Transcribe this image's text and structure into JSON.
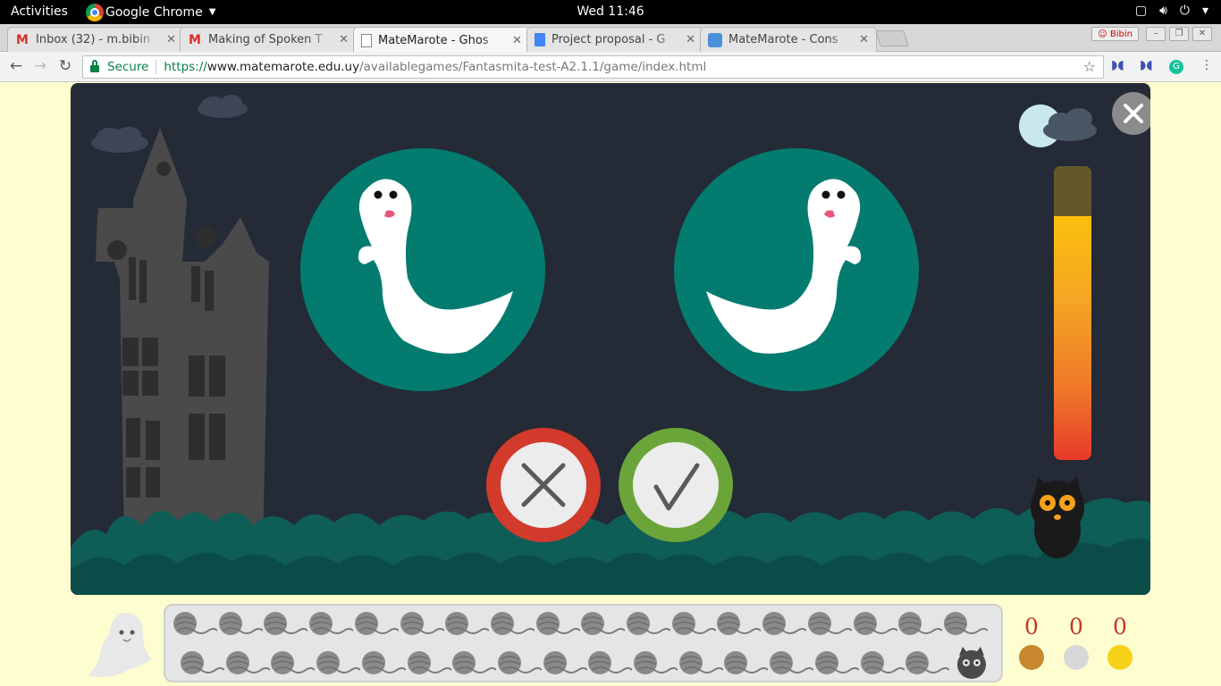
{
  "system_bar": {
    "activities": "Activities",
    "app_name": "Google Chrome",
    "clock": "Wed 11:46"
  },
  "tabs": [
    {
      "title": "Inbox (32) - m.bibin",
      "icon": "gmail-icon",
      "active": false
    },
    {
      "title": "Making of Spoken T",
      "icon": "gmail-icon",
      "active": false
    },
    {
      "title": "MateMarote - Ghos",
      "icon": "page-icon",
      "active": true
    },
    {
      "title": "Project proposal - G",
      "icon": "google-docs-icon",
      "active": false
    },
    {
      "title": "MateMarote - Cons",
      "icon": "matemarote-icon",
      "active": false
    }
  ],
  "profile_name": "Bibin",
  "omnibox": {
    "secure_label": "Secure",
    "scheme": "https://",
    "host": "www.matemarote.edu.uy",
    "path": "/availablegames/Fantasmita-test-A2.1.1/game/index.html"
  },
  "game": {
    "timer_remaining_fraction": 0.83,
    "ghost_left": "ghost-facing-right",
    "ghost_right": "ghost-facing-left",
    "buttons": [
      "wrong-answer",
      "correct-answer"
    ]
  },
  "hud": {
    "yarn_balls_total": 35,
    "yarn_balls_row1": 18,
    "yarn_balls_row2": 17,
    "medals": [
      {
        "name": "bronze",
        "count": "0",
        "color": "#c8862f"
      },
      {
        "name": "silver",
        "count": "0",
        "color": "#d8d8d8"
      },
      {
        "name": "gold",
        "count": "0",
        "color": "#f7d21a"
      }
    ]
  },
  "colors": {
    "game_bg": "#242a36",
    "card_teal": "#037c6f",
    "wrong_red": "#d23a2c",
    "correct_green": "#6ba53a",
    "page_bg": "#fdfdd0"
  }
}
